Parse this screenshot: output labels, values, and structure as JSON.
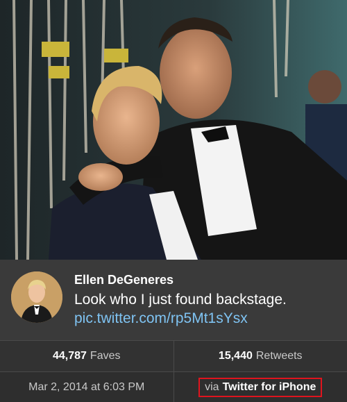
{
  "tweet": {
    "author": "Ellen DeGeneres",
    "text": "Look who I just found backstage.",
    "link": "pic.twitter.com/rp5Mt1sYsx"
  },
  "stats": {
    "faves_count": "44,787",
    "faves_label": "Faves",
    "retweets_count": "15,440",
    "retweets_label": "Retweets"
  },
  "meta": {
    "timestamp": "Mar 2, 2014 at 6:03 PM",
    "via_prefix": "via",
    "via_app": "Twitter for iPhone"
  },
  "colors": {
    "link": "#7fc3f2",
    "highlight_box": "#e0141e",
    "background": "#3a3a3a"
  }
}
